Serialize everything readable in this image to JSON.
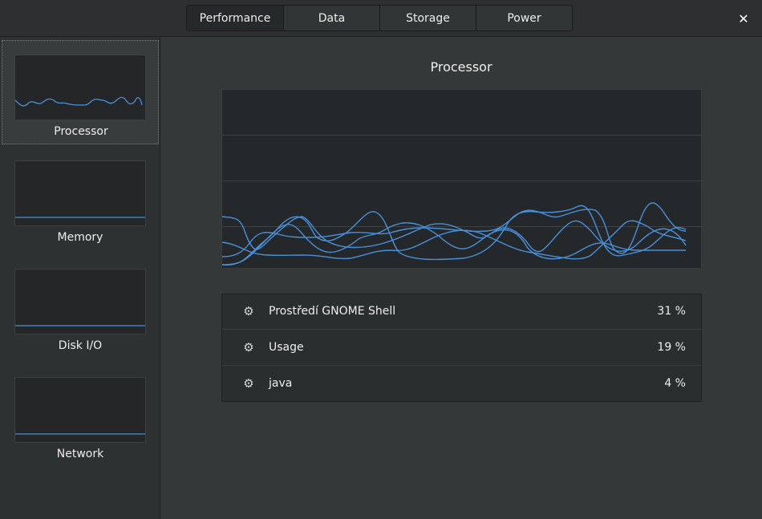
{
  "header": {
    "tabs": [
      {
        "label": "Performance",
        "active": true
      },
      {
        "label": "Data",
        "active": false
      },
      {
        "label": "Storage",
        "active": false
      },
      {
        "label": "Power",
        "active": false
      }
    ],
    "close_icon": "close-icon"
  },
  "sidebar": {
    "items": [
      {
        "label": "Processor",
        "selected": true
      },
      {
        "label": "Memory",
        "selected": false
      },
      {
        "label": "Disk I/O",
        "selected": false
      },
      {
        "label": "Network",
        "selected": false
      }
    ]
  },
  "main": {
    "title": "Processor",
    "processes": [
      {
        "name": "Prostředí GNOME Shell",
        "value": "31 %",
        "icon": "gears-icon"
      },
      {
        "name": "Usage",
        "value": "19 %",
        "icon": "gears-icon"
      },
      {
        "name": "java",
        "value": "4 %",
        "icon": "gears-icon"
      }
    ]
  },
  "colors": {
    "accent": "#4a90d9",
    "background": "#353839",
    "sidebar": "#2e3132",
    "graph_bg": "#25282a"
  }
}
